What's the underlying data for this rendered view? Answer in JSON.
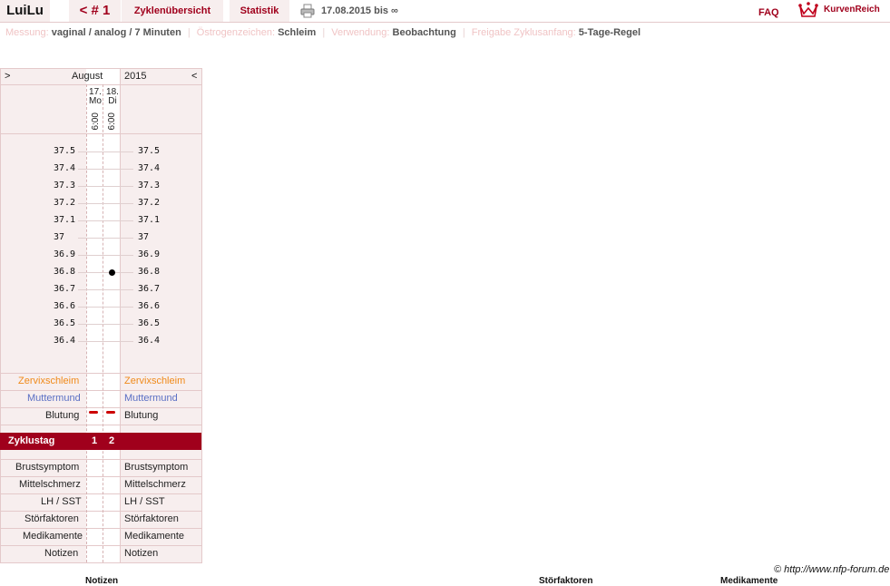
{
  "header": {
    "user": "LuiLu",
    "cycle": "< # 1",
    "tab_overview": "Zyklenübersicht",
    "tab_stats": "Statistik",
    "date_range": "17.08.2015 bis ∞",
    "faq": "FAQ",
    "brand": "KurvenReich"
  },
  "info": {
    "measure_label": "Messung:",
    "measure_value": "vaginal / analog / 7 Minuten",
    "estrogen_label": "Östrogenzeichen:",
    "estrogen_value": "Schleim",
    "usage_label": "Verwendung:",
    "usage_value": "Beobachtung",
    "release_label": "Freigabe Zyklusanfang:",
    "release_value": "5-Tage-Regel"
  },
  "chart": {
    "nav_prev": ">",
    "nav_next": "<",
    "month": "August",
    "year": "2015",
    "days": [
      {
        "date": "17.",
        "weekday": "Mo",
        "time": "6:00",
        "cycle_day": "1"
      },
      {
        "date": "18.",
        "weekday": "Di",
        "time": "6:00",
        "cycle_day": "2"
      }
    ],
    "temps": [
      "37.5",
      "37.4",
      "37.3",
      "37.2",
      "37.1",
      "37",
      "36.9",
      "36.8",
      "36.7",
      "36.6",
      "36.5",
      "36.4"
    ],
    "temp_readings": [
      null,
      36.8
    ],
    "rows_top": [
      "Zervixschleim",
      "Muttermund",
      "Blutung"
    ],
    "cycle_label": "Zyklustag",
    "rows_bottom": [
      "Brustsymptom",
      "Mittelschmerz",
      "LH / SST",
      "Störfaktoren",
      "Medikamente",
      "Notizen"
    ],
    "bleeding": [
      true,
      true
    ],
    "colors": {
      "cervix": "#f08a1a",
      "cervical_os": "#5a6fc4",
      "accent": "#a0001c"
    }
  },
  "footer": {
    "copyright": "© http://www.nfp-forum.de",
    "partial_notes": "Notizen",
    "partial_disruptors": "Störfaktoren",
    "partial_meds": "Medikamente"
  }
}
